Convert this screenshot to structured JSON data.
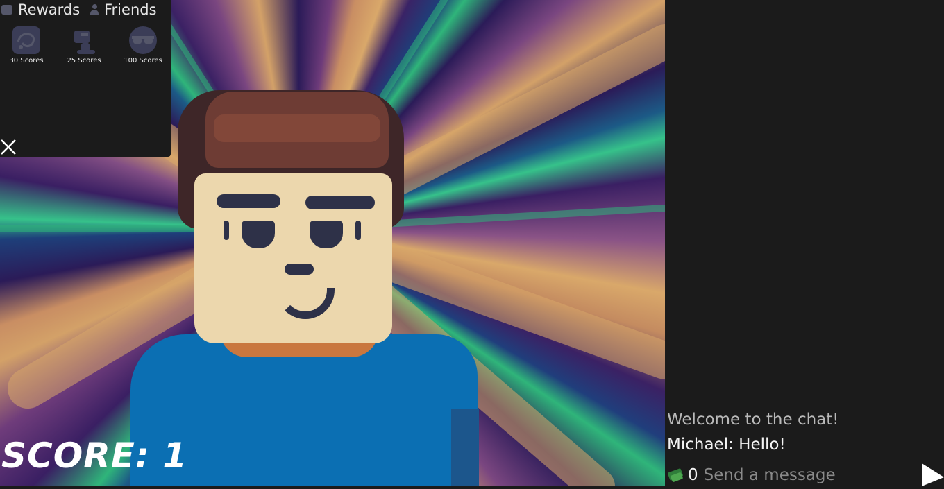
{
  "tabs": {
    "rewards": "Rewards",
    "friends": "Friends"
  },
  "rewards": [
    {
      "label": "30 Scores",
      "icon": "swirl-badge-icon"
    },
    {
      "label": "25 Scores",
      "icon": "hat-badge-icon"
    },
    {
      "label": "100 Scores",
      "icon": "sunglasses-badge-icon"
    }
  ],
  "score_text": "SCORE: 1",
  "chat": {
    "messages": [
      {
        "text": "Welcome to the chat!",
        "kind": "system"
      },
      {
        "text": "Michael: Hello!",
        "kind": "user"
      }
    ],
    "cash_count": "0",
    "input_placeholder": "Send a message"
  },
  "colors": {
    "chat_bg": "#1b1b1b",
    "shirt": "#0b6fb3",
    "hair": "#6e3c34",
    "skin": "#ecd7ad"
  }
}
